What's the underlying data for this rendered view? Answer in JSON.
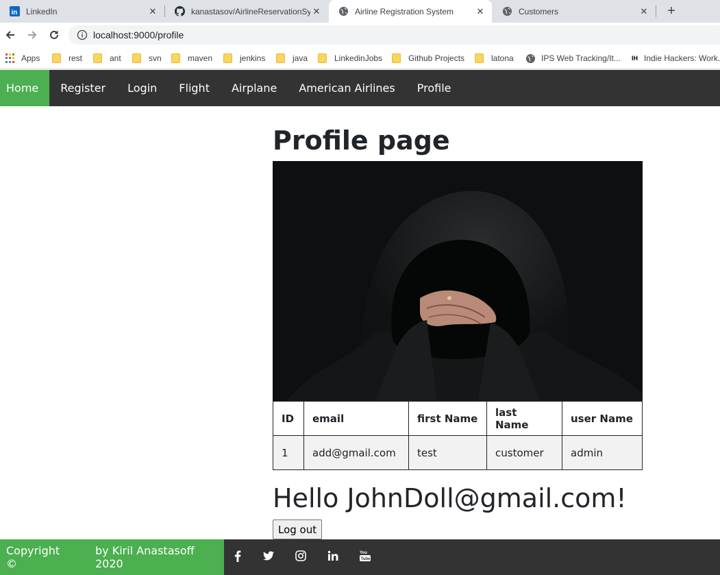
{
  "browser": {
    "tabs": [
      {
        "title": "LinkedIn",
        "icon": "linkedin-icon"
      },
      {
        "title": "kanastasov/AirlineReservationSys",
        "icon": "github-icon"
      },
      {
        "title": "Airline Registration System",
        "icon": "globe-icon",
        "active": true
      },
      {
        "title": "Customers",
        "icon": "globe-icon"
      }
    ],
    "url": "localhost:9000/profile",
    "bookmarks": [
      "Apps",
      "rest",
      "ant",
      "svn",
      "maven",
      "jenkins",
      "java",
      "LinkedinJobs",
      "Github Projects",
      "latona",
      "IPS Web Tracking/It...",
      "Indie Hackers: Work..."
    ]
  },
  "nav": {
    "items": [
      "Home",
      "Register",
      "Login",
      "Flight",
      "Airplane",
      "American Airlines",
      "Profile"
    ],
    "active": "Home",
    "accent": "#4caf50",
    "background": "#333333"
  },
  "page": {
    "title": "Profile page",
    "table": {
      "headers": [
        "ID",
        "email",
        "first Name",
        "last Name",
        "user Name"
      ],
      "rows": [
        [
          "1",
          "add@gmail.com",
          "test",
          "customer",
          "admin"
        ]
      ]
    },
    "greeting": "Hello JohnDoll@gmail.com!",
    "logout_label": "Log out"
  },
  "footer": {
    "copyright": "Copyright ©",
    "author": "by Kiril Anastasoff 2020",
    "social_icons": [
      "facebook-icon",
      "twitter-icon",
      "instagram-icon",
      "linkedin-icon",
      "youtube-icon"
    ]
  }
}
